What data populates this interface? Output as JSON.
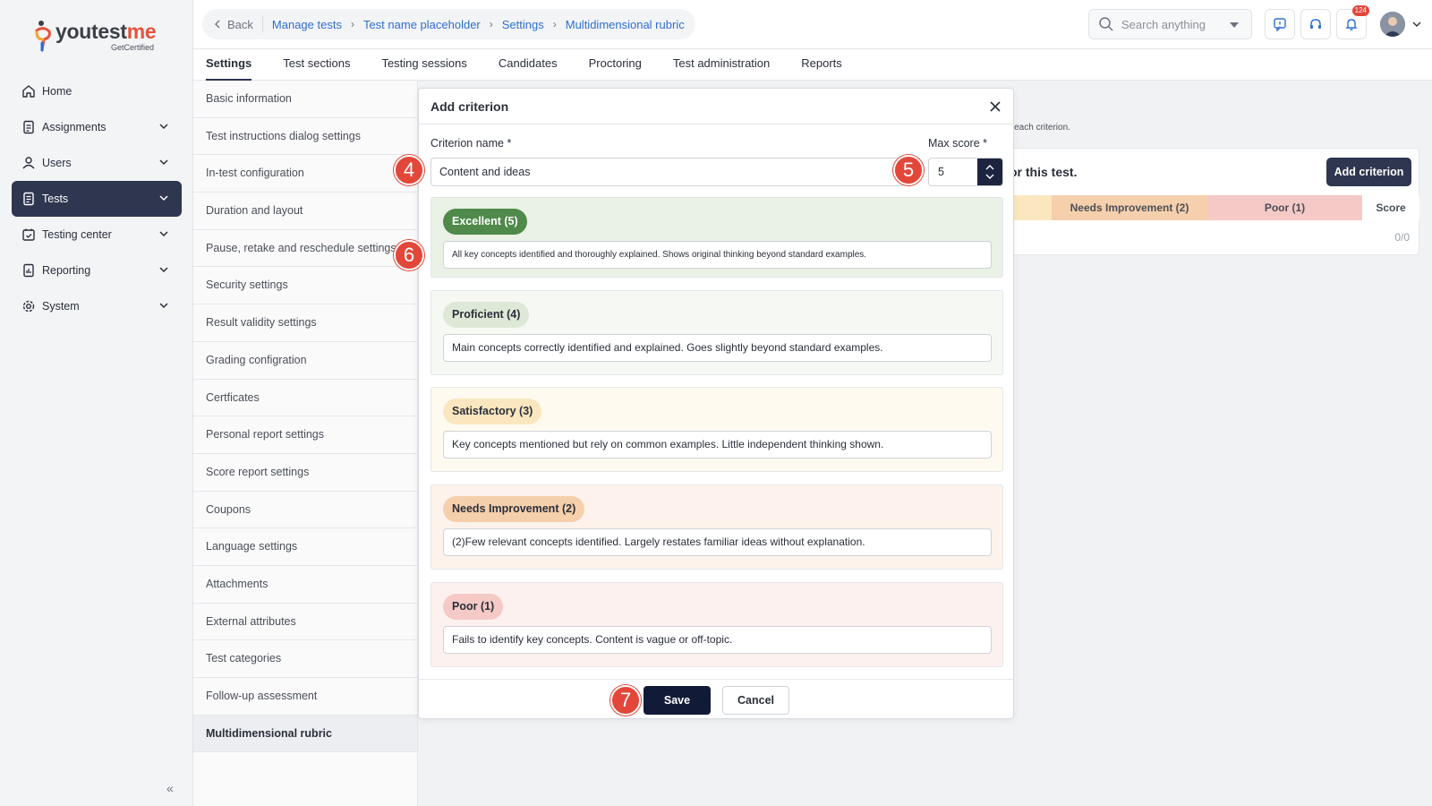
{
  "logo": {
    "brand": "youtestme",
    "brand_part1": "youtest",
    "brand_part2": "me",
    "tagline": "GetCertified"
  },
  "nav": {
    "items": [
      {
        "label": "Home",
        "icon": "home-icon"
      },
      {
        "label": "Assignments",
        "icon": "assignment-icon"
      },
      {
        "label": "Users",
        "icon": "users-icon"
      },
      {
        "label": "Tests",
        "icon": "tests-icon"
      },
      {
        "label": "Testing center",
        "icon": "calendar-check-icon"
      },
      {
        "label": "Reporting",
        "icon": "report-icon"
      },
      {
        "label": "System",
        "icon": "gear-icon"
      }
    ],
    "active": "Tests"
  },
  "breadcrumb": {
    "back": "Back",
    "items": [
      "Manage tests",
      "Test name placeholder",
      "Settings",
      "Multidimensional rubric"
    ]
  },
  "search": {
    "placeholder": "Search anything"
  },
  "header": {
    "notification_count": "124"
  },
  "tabs": [
    "Settings",
    "Test sections",
    "Testing sessions",
    "Candidates",
    "Proctoring",
    "Test administration",
    "Reports"
  ],
  "settings_menu": [
    "Basic information",
    "Test instructions dialog settings",
    "In-test configuration",
    "Duration and layout",
    "Pause, retake and reschedule settings",
    "Security settings",
    "Result validity settings",
    "Grading configration",
    "Certficates",
    "Personal report settings",
    "Score report settings",
    "Coupons",
    "Language settings",
    "Attachments",
    "External  attributes",
    "Test categories",
    "Follow-up assessment",
    "Multidimensional rubric"
  ],
  "background": {
    "desc_fragment": "r each criterion.",
    "card_title_fragment": "or this test.",
    "add_criterion_label": "Add criterion",
    "columns": [
      "Needs Improvement (2)",
      "Poor (1)",
      "Score"
    ],
    "score": "0/0"
  },
  "modal": {
    "title": "Add criterion",
    "criterion_label": "Criterion name *",
    "criterion_value": "Content and ideas",
    "max_score_label": "Max score *",
    "max_score_value": "5",
    "levels": [
      {
        "name": "Excellent (5)",
        "description": "All key concepts identified and thoroughly explained. Shows original thinking beyond standard examples.",
        "bg": "#eaf1e6",
        "pill": "#4f8a4a",
        "pill_text": "#ffffff"
      },
      {
        "name": "Proficient (4)",
        "description": "Main concepts correctly identified and explained. Goes slightly beyond standard examples.",
        "bg": "#f6f8f4",
        "pill": "#dde8d6",
        "pill_text": "#2a2f3a"
      },
      {
        "name": "Satisfactory (3)",
        "description": "Key concepts mentioned but rely on common examples. Little independent thinking shown.",
        "bg": "#fffaf0",
        "pill": "#fbe7bf",
        "pill_text": "#2a2f3a"
      },
      {
        "name": "Needs Improvement (2)",
        "description": "(2)Few relevant concepts identified. Largely restates familiar ideas without explanation.",
        "bg": "#fdf3ec",
        "pill": "#f6cfac",
        "pill_text": "#2a2f3a"
      },
      {
        "name": "Poor (1)",
        "description": "Fails to identify key concepts. Content is vague or off-topic.",
        "bg": "#fdf1f0",
        "pill": "#f5c9c6",
        "pill_text": "#2a2f3a"
      }
    ],
    "save_label": "Save",
    "cancel_label": "Cancel"
  },
  "markers": [
    "4",
    "5",
    "6",
    "7"
  ],
  "colors": {
    "primary": "#2e3650",
    "link": "#2e6fd0",
    "marker": "#e2473a"
  }
}
